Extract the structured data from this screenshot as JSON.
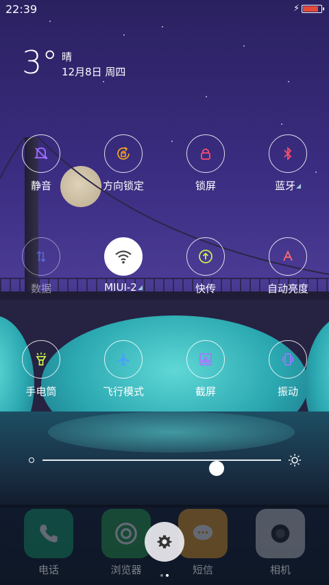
{
  "status_bar": {
    "time": "22:39",
    "battery_level": 0.85,
    "charging_icon": "lightning-icon",
    "battery_color": "#e34a3a"
  },
  "weather": {
    "temperature": "3°",
    "condition": "晴",
    "date": "12月8日 周四"
  },
  "quick_toggles": [
    {
      "id": "mute",
      "label": "静音",
      "icon": "bell-off-icon",
      "color": "#a070ff",
      "state": "off"
    },
    {
      "id": "rotation-lock",
      "label": "方向锁定",
      "icon": "rotation-lock-icon",
      "color": "#f0a020",
      "state": "off"
    },
    {
      "id": "lock-screen",
      "label": "锁屏",
      "icon": "lock-icon",
      "color": "#ff4d6d",
      "state": "off"
    },
    {
      "id": "bluetooth",
      "label": "蓝牙",
      "icon": "bluetooth-icon",
      "color": "#ff4d6d",
      "state": "off",
      "has_more": true
    },
    {
      "id": "mobile-data",
      "label": "数据",
      "icon": "data-arrows-icon",
      "color": "#6a8cff",
      "state": "disabled"
    },
    {
      "id": "wifi",
      "label": "MIUI-2",
      "icon": "wifi-icon",
      "color": "#444444",
      "state": "on",
      "has_more": true
    },
    {
      "id": "quick-share",
      "label": "快传",
      "icon": "upload-icon",
      "color": "#c8f050",
      "state": "off"
    },
    {
      "id": "auto-brightness",
      "label": "自动亮度",
      "icon": "letter-a-icon",
      "color": "#ff6b6b",
      "state": "off"
    },
    {
      "id": "flashlight",
      "label": "手电筒",
      "icon": "flashlight-icon",
      "color": "#c8f050",
      "state": "off"
    },
    {
      "id": "airplane-mode",
      "label": "飞行模式",
      "icon": "airplane-icon",
      "color": "#4aa0ff",
      "state": "off"
    },
    {
      "id": "screenshot",
      "label": "截屏",
      "icon": "screenshot-icon",
      "color": "#b070ff",
      "state": "off"
    },
    {
      "id": "vibrate",
      "label": "振动",
      "icon": "vibrate-icon",
      "color": "#9a7bff",
      "state": "off"
    }
  ],
  "brightness": {
    "level": 0.73
  },
  "dock": [
    {
      "label": "电话",
      "icon": "phone-icon",
      "color": "#13a06a"
    },
    {
      "label": "浏览器",
      "icon": "browser-icon",
      "color": "#27a24a"
    },
    {
      "label": "短信",
      "icon": "message-icon",
      "color": "#f0a020"
    },
    {
      "label": "相机",
      "icon": "camera-icon",
      "color": "#cfcfcf"
    }
  ],
  "settings_button": {
    "icon": "gear-icon"
  },
  "pagination": {
    "pages": 2,
    "current": 2
  }
}
